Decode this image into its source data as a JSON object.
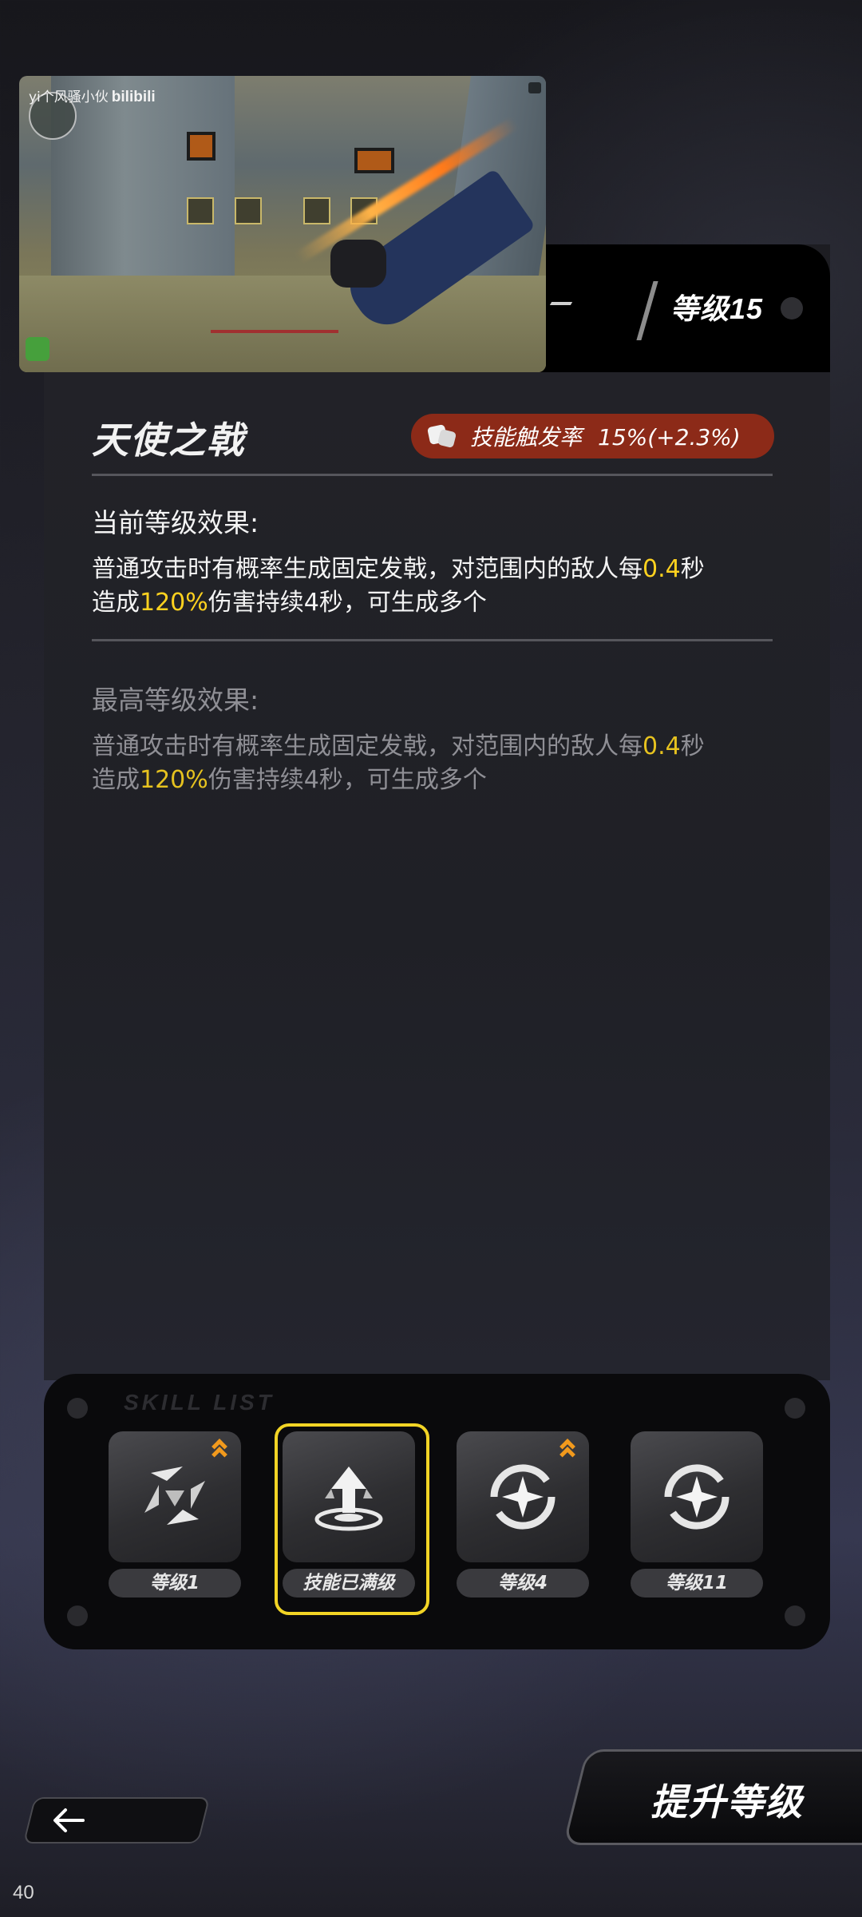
{
  "header": {
    "level_label": "等级15"
  },
  "video": {
    "watermark_channel": "yi个风骚小伙",
    "watermark_site": "bilibili"
  },
  "skill": {
    "name": "天使之戟",
    "trigger": {
      "label": "技能触发率",
      "value": "15%(+2.3%)"
    }
  },
  "current": {
    "heading": "当前等级效果:",
    "desc_parts": [
      "普通攻击时有概率生成固定发戟，对范围内的敌人每",
      "0.4",
      "秒",
      "造成",
      "120%",
      "伤害持续4秒，可生成多个"
    ]
  },
  "max": {
    "heading": "最高等级效果:",
    "desc_parts": [
      "普通攻击时有概率生成固定发戟，对范围内的敌人每",
      "0.4",
      "秒",
      "造成",
      "120%",
      "伤害持续4秒，可生成多个"
    ]
  },
  "tray": {
    "logo": "SKILL LIST",
    "slots": [
      {
        "label": "等级1",
        "icon": "blade-swirl-icon",
        "upgradable": true
      },
      {
        "label": "技能已满级",
        "icon": "rising-arrow-icon",
        "upgradable": false,
        "selected": true
      },
      {
        "label": "等级4",
        "icon": "compass-star-icon",
        "upgradable": true
      },
      {
        "label": "等级11",
        "icon": "compass-star-icon",
        "upgradable": false
      }
    ]
  },
  "buttons": {
    "upgrade": "提升等级",
    "back_icon": "arrow-left-icon"
  },
  "footer": {
    "page_number": "40"
  },
  "colors": {
    "highlight": "#ffd21f",
    "trigger_pill": "#8c2a18",
    "upgrade_arrow": "#f29a1d",
    "selected_border": "#f2d425"
  }
}
